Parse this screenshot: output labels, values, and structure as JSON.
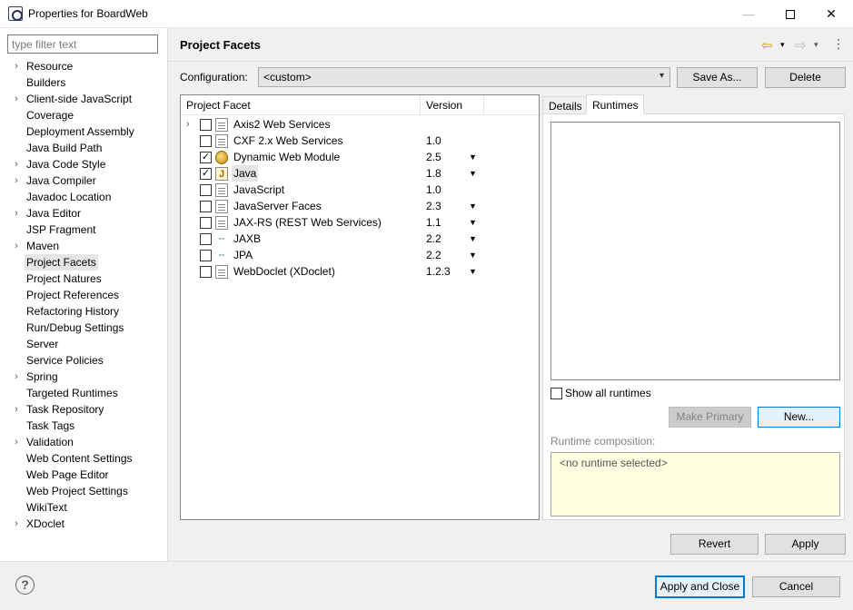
{
  "window": {
    "title": "Properties for BoardWeb",
    "min_glyph": "—",
    "close_glyph": "✕"
  },
  "sidebar": {
    "filter_placeholder": "type filter text",
    "expander_glyph": "›",
    "items": [
      {
        "label": "Resource",
        "expandable": true
      },
      {
        "label": "Builders",
        "expandable": false
      },
      {
        "label": "Client-side JavaScript",
        "expandable": true
      },
      {
        "label": "Coverage",
        "expandable": false
      },
      {
        "label": "Deployment Assembly",
        "expandable": false
      },
      {
        "label": "Java Build Path",
        "expandable": false
      },
      {
        "label": "Java Code Style",
        "expandable": true
      },
      {
        "label": "Java Compiler",
        "expandable": true
      },
      {
        "label": "Javadoc Location",
        "expandable": false
      },
      {
        "label": "Java Editor",
        "expandable": true
      },
      {
        "label": "JSP Fragment",
        "expandable": false
      },
      {
        "label": "Maven",
        "expandable": true
      },
      {
        "label": "Project Facets",
        "expandable": false,
        "selected": true
      },
      {
        "label": "Project Natures",
        "expandable": false
      },
      {
        "label": "Project References",
        "expandable": false
      },
      {
        "label": "Refactoring History",
        "expandable": false
      },
      {
        "label": "Run/Debug Settings",
        "expandable": false
      },
      {
        "label": "Server",
        "expandable": false
      },
      {
        "label": "Service Policies",
        "expandable": false
      },
      {
        "label": "Spring",
        "expandable": true
      },
      {
        "label": "Targeted Runtimes",
        "expandable": false
      },
      {
        "label": "Task Repository",
        "expandable": true
      },
      {
        "label": "Task Tags",
        "expandable": false
      },
      {
        "label": "Validation",
        "expandable": true
      },
      {
        "label": "Web Content Settings",
        "expandable": false
      },
      {
        "label": "Web Page Editor",
        "expandable": false
      },
      {
        "label": "Web Project Settings",
        "expandable": false
      },
      {
        "label": "WikiText",
        "expandable": false
      },
      {
        "label": "XDoclet",
        "expandable": true
      }
    ]
  },
  "main": {
    "title": "Project Facets",
    "config_label": "Configuration:",
    "config_value": "<custom>",
    "save_as_label": "Save As...",
    "delete_label": "Delete",
    "facets": {
      "col_facet": "Project Facet",
      "col_version": "Version",
      "check_glyph": "✓",
      "dropdown_glyph": "▼",
      "rows": [
        {
          "name": "Axis2 Web Services",
          "version": "",
          "checked": false,
          "expandable": true,
          "icon": "page-icon",
          "has_dropdown": false
        },
        {
          "name": "CXF 2.x Web Services",
          "version": "1.0",
          "checked": false,
          "expandable": false,
          "icon": "page-icon",
          "has_dropdown": false
        },
        {
          "name": "Dynamic Web Module",
          "version": "2.5",
          "checked": true,
          "expandable": false,
          "icon": "web-module-icon",
          "has_dropdown": true
        },
        {
          "name": "Java",
          "version": "1.8",
          "checked": true,
          "expandable": false,
          "icon": "java-icon",
          "has_dropdown": true,
          "selected": true
        },
        {
          "name": "JavaScript",
          "version": "1.0",
          "checked": false,
          "expandable": false,
          "icon": "page-icon",
          "has_dropdown": false
        },
        {
          "name": "JavaServer Faces",
          "version": "2.3",
          "checked": false,
          "expandable": false,
          "icon": "page-icon",
          "has_dropdown": true
        },
        {
          "name": "JAX-RS (REST Web Services)",
          "version": "1.1",
          "checked": false,
          "expandable": false,
          "icon": "page-icon",
          "has_dropdown": true
        },
        {
          "name": "JAXB",
          "version": "2.2",
          "checked": false,
          "expandable": false,
          "icon": "binding-icon",
          "has_dropdown": true
        },
        {
          "name": "JPA",
          "version": "2.2",
          "checked": false,
          "expandable": false,
          "icon": "binding-icon",
          "has_dropdown": true
        },
        {
          "name": "WebDoclet (XDoclet)",
          "version": "1.2.3",
          "checked": false,
          "expandable": false,
          "icon": "page-icon",
          "has_dropdown": true
        }
      ]
    },
    "tabs": {
      "details_label": "Details",
      "runtimes_label": "Runtimes"
    },
    "runtimes": {
      "show_all_label": "Show all runtimes",
      "make_primary_label": "Make Primary",
      "new_label": "New...",
      "composition_label": "Runtime composition:",
      "composition_value": "<no runtime selected>"
    },
    "revert_label": "Revert",
    "apply_label": "Apply"
  },
  "footer": {
    "help_glyph": "?",
    "apply_close_label": "Apply and Close",
    "cancel_label": "Cancel"
  },
  "toolbar": {
    "back_glyph": "⇦",
    "forward_glyph": "⇨",
    "menu_glyph": "▾",
    "more_glyph": "⋮"
  }
}
